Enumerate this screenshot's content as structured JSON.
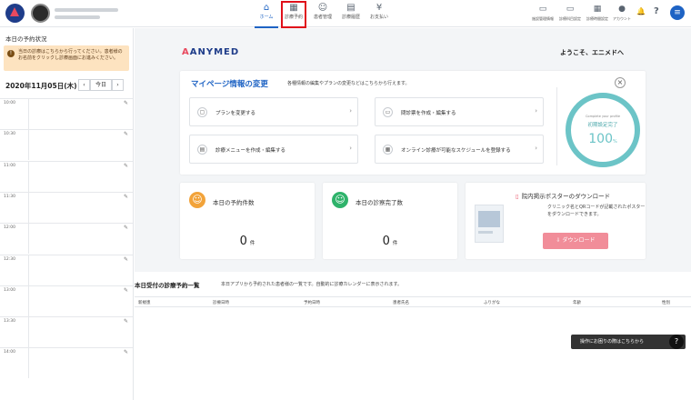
{
  "topbar": {
    "nav": [
      {
        "label": "ホーム",
        "icon": "home-icon",
        "glyph": "⌂"
      },
      {
        "label": "診療予約",
        "icon": "calendar-icon",
        "glyph": "▦"
      },
      {
        "label": "患者管理",
        "icon": "patients-icon",
        "glyph": "☺"
      },
      {
        "label": "診療履歴",
        "icon": "history-icon",
        "glyph": "▤"
      },
      {
        "label": "お支払い",
        "icon": "payment-icon",
        "glyph": "¥"
      }
    ],
    "right_nav": [
      {
        "label": "施設管理情報",
        "glyph": "▭"
      },
      {
        "label": "診療科目設定",
        "glyph": "▭"
      },
      {
        "label": "診療時間設定",
        "glyph": "▦"
      },
      {
        "label": "アカウント",
        "glyph": "●"
      }
    ],
    "bell_glyph": "🔔",
    "help_glyph": "?",
    "menu_glyph": "≡"
  },
  "left": {
    "title": "本日の予約状況",
    "notice": "当日の診療はこちらから行ってください。患者様のお名前をクリックし診療画面にお進みください。",
    "date": "2020年11月05日(木)",
    "today": "今日",
    "prev": "‹",
    "next": "›",
    "times": [
      "10:00",
      "10:30",
      "11:00",
      "11:30",
      "12:00",
      "12:30",
      "13:00",
      "13:30",
      "14:00"
    ],
    "edit_glyph": "✎"
  },
  "main": {
    "brand_a": "A",
    "brand_rest": "ANYMED",
    "welcome": "ようこそ、エニメドへ",
    "mypage": {
      "title": "マイページ情報の変更",
      "sub": "各種情報の編集やプランの変更などはこちらから行えます。",
      "close": "×",
      "actions": [
        {
          "label": "プランを変更する",
          "glyph": "▢"
        },
        {
          "label": "問診票を作成・編集する",
          "glyph": "▭"
        },
        {
          "label": "診療メニューを作成・編集する",
          "glyph": "▤"
        },
        {
          "label": "オンライン診療が可能なスケジュールを登録する",
          "glyph": "▦"
        }
      ],
      "chev": "›"
    },
    "profile": {
      "caption": "Complete your profile",
      "status": "初期設定完了",
      "percent": "100",
      "unit": "%"
    },
    "stats": [
      {
        "label": "本日の予約件数",
        "value": "0",
        "unit": "件",
        "color": "#f2a33a",
        "glyph": "☺"
      },
      {
        "label": "本日の診察完了数",
        "value": "0",
        "unit": "件",
        "color": "#2fb36b",
        "glyph": "☺"
      }
    ],
    "poster": {
      "title": "院内掲示ポスターのダウンロード",
      "desc": "クリニック名とQRコードが記載されたポスターをダウンロードできます。",
      "button": "ダウンロード",
      "icon_glyph": "▯",
      "dl_glyph": "⇩"
    },
    "table": {
      "title": "本日受付の診療予約一覧",
      "sub": "本日アプリから予約された患者様の一覧です。自動的に診療カレンダーに表示されます。",
      "columns": [
        "新規患",
        "診療日時",
        "予約日時",
        "患者氏名",
        "ふりがな",
        "年齢",
        "性別"
      ]
    },
    "help": "操作にお困りの際はこちらから",
    "help_q": "?"
  }
}
